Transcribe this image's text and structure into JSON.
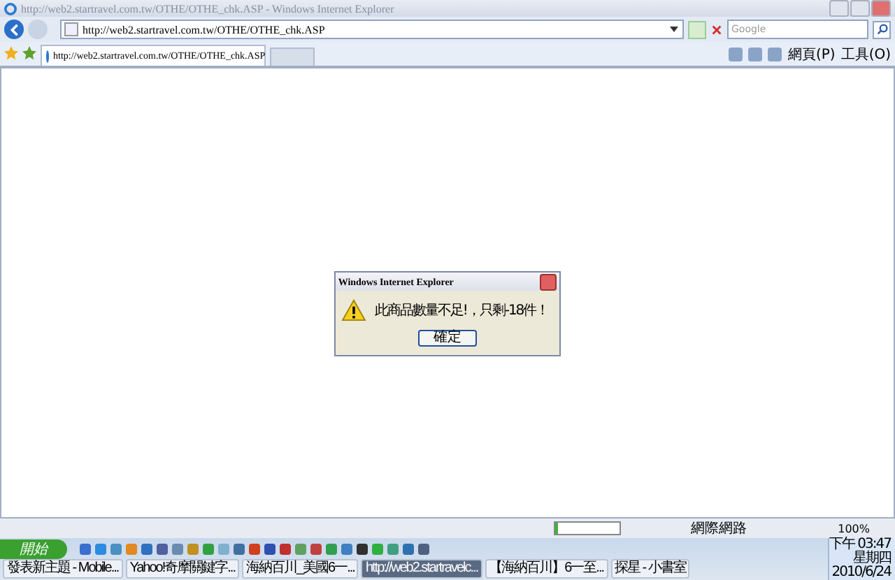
{
  "window": {
    "title": "http://web2.startravel.com.tw/OTHE/OTHE_chk.ASP - Windows Internet Explorer"
  },
  "address_bar": {
    "value": "http://web2.startravel.com.tw/OTHE/OTHE_chk.ASP"
  },
  "search": {
    "placeholder": "Google"
  },
  "tabs": [
    {
      "label": "http://web2.startravel.com.tw/OTHE/OTHE_chk.ASP",
      "selected": true
    }
  ],
  "command_bar": {
    "items": [
      "網頁(P)",
      "工具(O)"
    ]
  },
  "dialog": {
    "title": "Windows Internet Explorer",
    "message": "此商品數量不足!，只剩-18件！",
    "button": "確定"
  },
  "status_bar": {
    "progress": {
      "level": 0.05
    },
    "zone": "網際網路",
    "zoom": "100%"
  },
  "taskbar": {
    "start": "開始",
    "buttons": [
      {
        "label": "發表新主題 - Mobile...",
        "selected": false
      },
      {
        "label": "Yahoo!奇摩關鍵字...",
        "selected": false
      },
      {
        "label": "海納百川_美國6一...",
        "selected": false
      },
      {
        "label": "http://web2.startravelc...",
        "selected": true
      },
      {
        "label": "【海納百川】6一至...",
        "selected": false
      },
      {
        "label": "探星 - 小書室",
        "selected": false
      }
    ],
    "clock": [
      "下午 03:47",
      "星期四",
      "2010/6/24"
    ]
  }
}
